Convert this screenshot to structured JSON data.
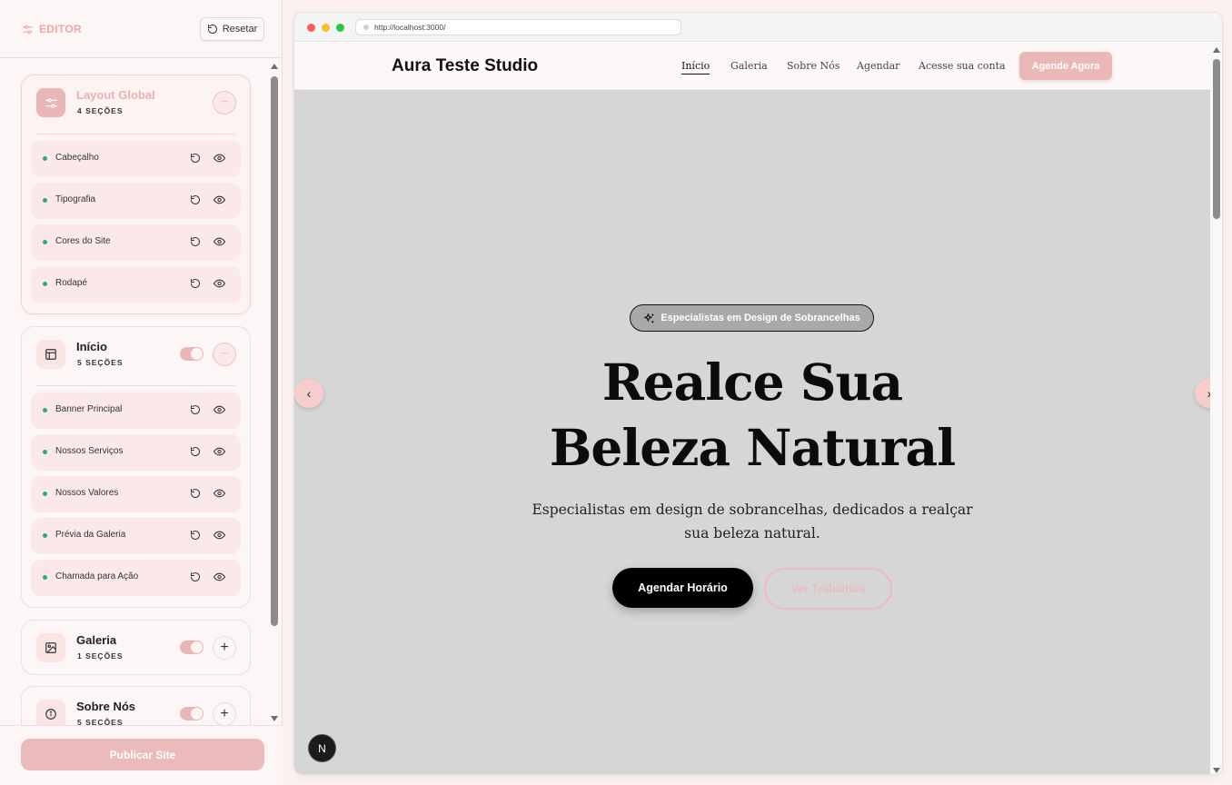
{
  "sidebar": {
    "title": "EDITOR",
    "reset_label": "Resetar",
    "publish_label": "Publicar Site",
    "groups": [
      {
        "name": "Layout Global",
        "count": "4 SEÇÕES",
        "icon": "sliders-icon",
        "sections": [
          {
            "label": "Cabeçalho"
          },
          {
            "label": "Tipografia"
          },
          {
            "label": "Cores do Site"
          },
          {
            "label": "Rodapé"
          }
        ]
      },
      {
        "name": "Início",
        "count": "5 SEÇÕES",
        "icon": "layout-icon",
        "sections": [
          {
            "label": "Banner Principal"
          },
          {
            "label": "Nossos Serviços"
          },
          {
            "label": "Nossos Valores"
          },
          {
            "label": "Prévia da Galeria"
          },
          {
            "label": "Chamada para Ação"
          }
        ]
      },
      {
        "name": "Galeria",
        "count": "1 SEÇÕES",
        "icon": "image-icon"
      },
      {
        "name": "Sobre Nós",
        "count": "5 SEÇÕES",
        "icon": "info-icon"
      }
    ]
  },
  "browser": {
    "url": "http://localhost:3000/"
  },
  "site": {
    "brand": "Aura Teste Studio",
    "nav": [
      "Início",
      "Galeria",
      "Sobre Nós",
      "Agendar",
      "Acesse sua conta"
    ],
    "nav_cta": "Agende Agora",
    "hero": {
      "badge": "Especialistas em Design de Sobrancelhas",
      "title_line1": "Realce Sua",
      "title_line2": "Beleza Natural",
      "subtitle": "Especialistas em design de sobrancelhas, dedicados a realçar sua beleza natural.",
      "primary_button": "Agendar Horário",
      "secondary_button": "Ver Trabalhos"
    },
    "n_badge": "N"
  },
  "colors": {
    "accent_pink": "#ebb8b8",
    "status_green": "#22b26a",
    "hero_bg": "#d6d6d6"
  }
}
